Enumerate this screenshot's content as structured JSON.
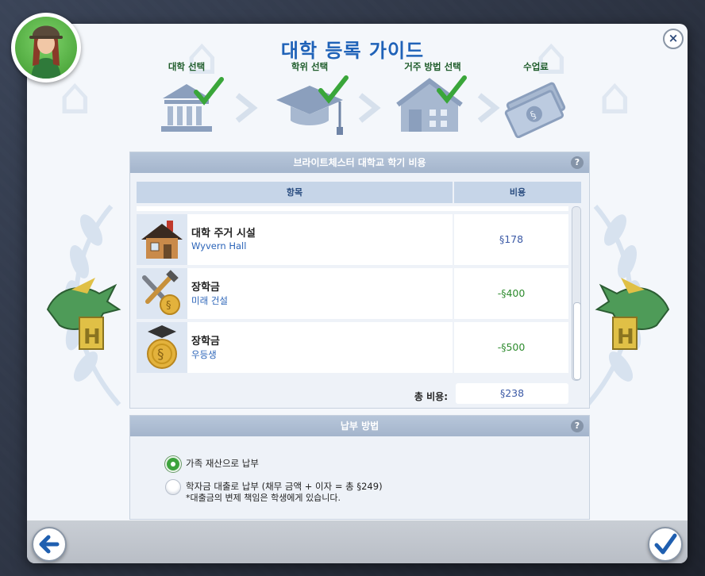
{
  "title": "대학 등록 가이드",
  "steps": [
    {
      "label": "대학 선택",
      "done": true,
      "icon": "university-building-icon"
    },
    {
      "label": "학위 선택",
      "done": true,
      "icon": "graduation-cap-icon"
    },
    {
      "label": "거주 방법 선택",
      "done": true,
      "icon": "housing-icon"
    },
    {
      "label": "수업료",
      "done": false,
      "icon": "money-icon"
    }
  ],
  "cost_panel": {
    "title": "브라이트체스터 대학교 학기 비용",
    "help": "?",
    "columns": {
      "item": "항목",
      "cost": "비용"
    },
    "rows": [
      {
        "title": "대학 주거 시설",
        "subtitle": "Wyvern Hall",
        "cost": "178",
        "negative": false,
        "icon": "house-icon"
      },
      {
        "title": "장학금",
        "subtitle": "미래 건설",
        "cost": "400",
        "negative": true,
        "icon": "tools-medal-icon"
      },
      {
        "title": "장학금",
        "subtitle": "우등생",
        "cost": "500",
        "negative": true,
        "icon": "grad-medal-icon"
      }
    ],
    "total_label": "총 비용:",
    "total_value": "238"
  },
  "payment_panel": {
    "title": "납부 방법",
    "help": "?",
    "options": [
      {
        "label": "가족 재산으로 납부",
        "selected": true
      },
      {
        "label": "학자금 대출로 납부 (채무 금액 + 이자 = 총 ",
        "amount": "249",
        "suffix": ")",
        "note": "*대출금의 변제 책임은 학생에게 있습니다.",
        "selected": false
      }
    ]
  },
  "buttons": {
    "close": "×"
  },
  "colors": {
    "title": "#1f62b8",
    "check": "#3aa63a",
    "negative": "#2e8b2e",
    "positive": "#3c5aa6"
  }
}
